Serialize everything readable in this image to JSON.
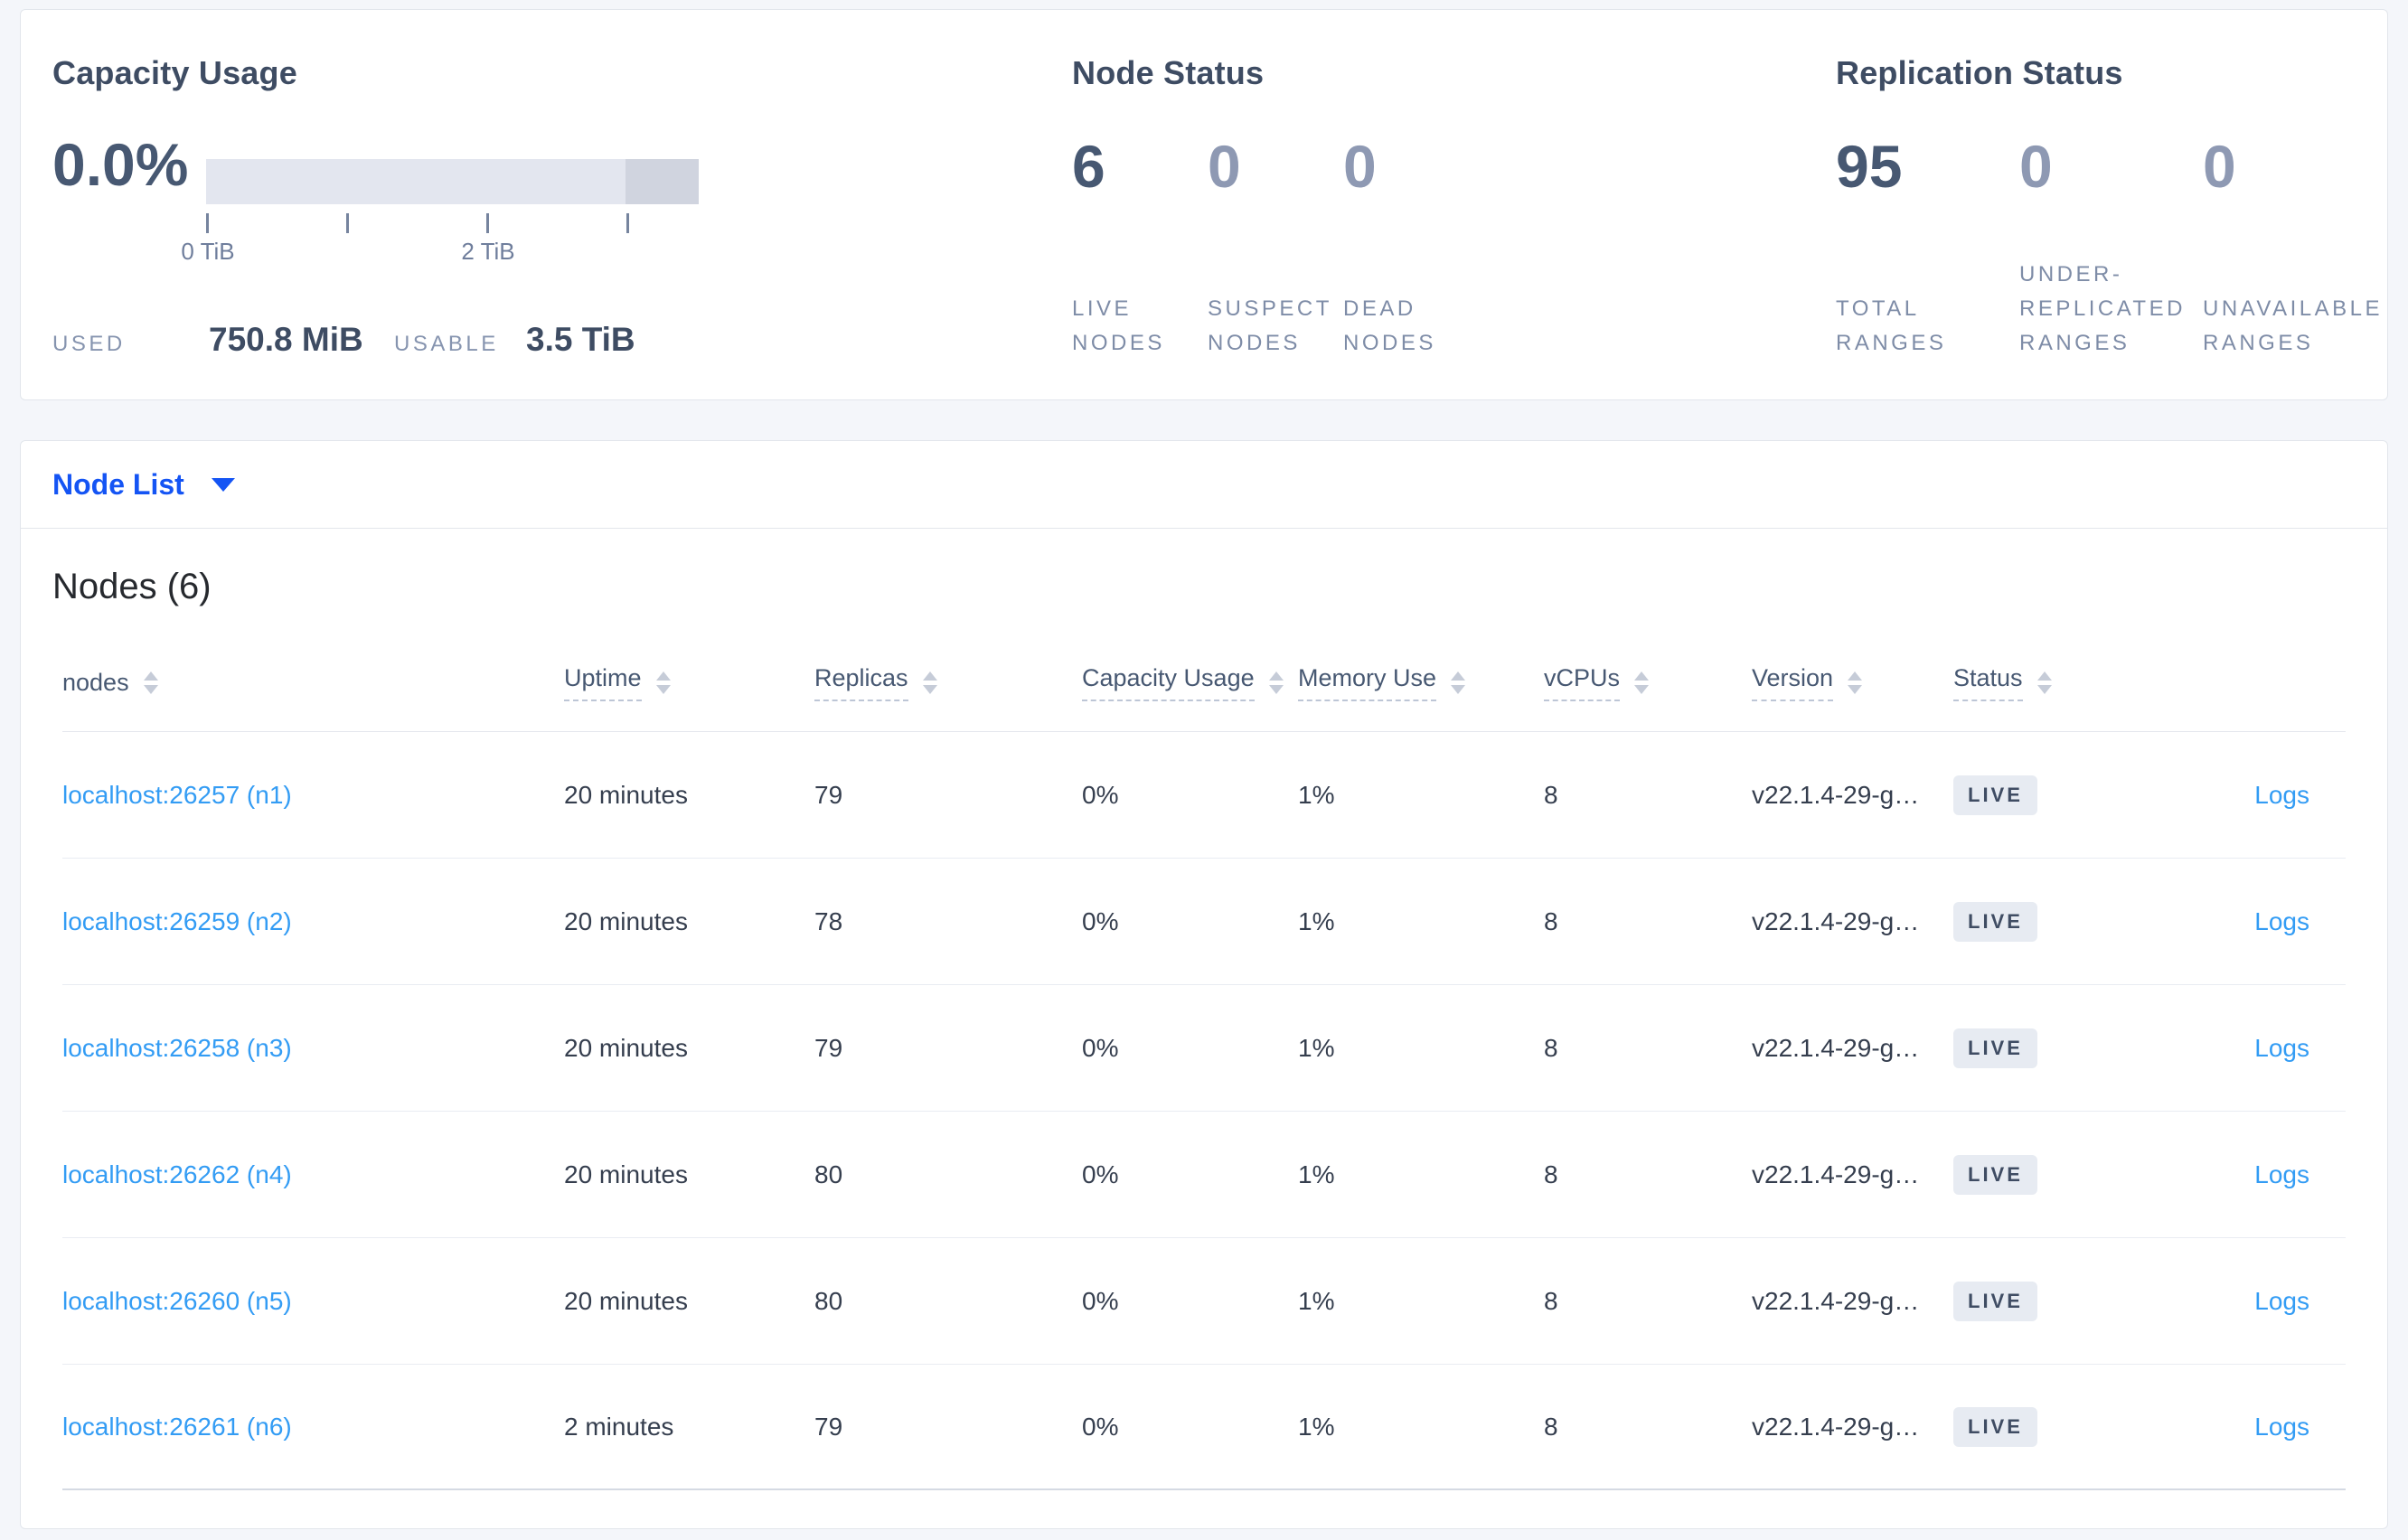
{
  "summary": {
    "capacity": {
      "title": "Capacity Usage",
      "percent": "0.0%",
      "tick_labels": [
        "0 TiB",
        "2 TiB"
      ],
      "used_label": "USED",
      "used_value": "750.8 MiB",
      "usable_label": "USABLE",
      "usable_value": "3.5 TiB"
    },
    "node_status": {
      "title": "Node Status",
      "stats": [
        {
          "value": "6",
          "label": "LIVE NODES"
        },
        {
          "value": "0",
          "label": "SUSPECT NODES"
        },
        {
          "value": "0",
          "label": "DEAD NODES"
        }
      ]
    },
    "replication": {
      "title": "Replication Status",
      "stats": [
        {
          "value": "95",
          "label": "TOTAL RANGES"
        },
        {
          "value": "0",
          "label": "UNDER-REPLICATED RANGES"
        },
        {
          "value": "0",
          "label": "UNAVAILABLE RANGES"
        }
      ]
    }
  },
  "node_list": {
    "dropdown_label": "Node List",
    "heading": "Nodes (6)",
    "columns": {
      "nodes": "nodes",
      "uptime": "Uptime",
      "replicas": "Replicas",
      "capacity": "Capacity Usage",
      "memory": "Memory Use",
      "vcpus": "vCPUs",
      "version": "Version",
      "status": "Status"
    },
    "rows": [
      {
        "node": "localhost:26257 (n1)",
        "uptime": "20 minutes",
        "replicas": "79",
        "capacity": "0%",
        "memory": "1%",
        "vcpus": "8",
        "version": "v22.1.4-29-g…",
        "status": "LIVE",
        "logs": "Logs"
      },
      {
        "node": "localhost:26259 (n2)",
        "uptime": "20 minutes",
        "replicas": "78",
        "capacity": "0%",
        "memory": "1%",
        "vcpus": "8",
        "version": "v22.1.4-29-g…",
        "status": "LIVE",
        "logs": "Logs"
      },
      {
        "node": "localhost:26258 (n3)",
        "uptime": "20 minutes",
        "replicas": "79",
        "capacity": "0%",
        "memory": "1%",
        "vcpus": "8",
        "version": "v22.1.4-29-g…",
        "status": "LIVE",
        "logs": "Logs"
      },
      {
        "node": "localhost:26262 (n4)",
        "uptime": "20 minutes",
        "replicas": "80",
        "capacity": "0%",
        "memory": "1%",
        "vcpus": "8",
        "version": "v22.1.4-29-g…",
        "status": "LIVE",
        "logs": "Logs"
      },
      {
        "node": "localhost:26260 (n5)",
        "uptime": "20 minutes",
        "replicas": "80",
        "capacity": "0%",
        "memory": "1%",
        "vcpus": "8",
        "version": "v22.1.4-29-g…",
        "status": "LIVE",
        "logs": "Logs"
      },
      {
        "node": "localhost:26261 (n6)",
        "uptime": "2 minutes",
        "replicas": "79",
        "capacity": "0%",
        "memory": "1%",
        "vcpus": "8",
        "version": "v22.1.4-29-g…",
        "status": "LIVE",
        "logs": "Logs"
      }
    ]
  },
  "colors": {
    "accent_blue": "#1454F4",
    "link_blue": "#339CF4",
    "number_dark": "#475872",
    "number_muted": "#8E99B3",
    "bar_light": "#E3E6EF",
    "bar_dark": "#D0D4DF",
    "badge_bg": "#E7EBF2"
  }
}
